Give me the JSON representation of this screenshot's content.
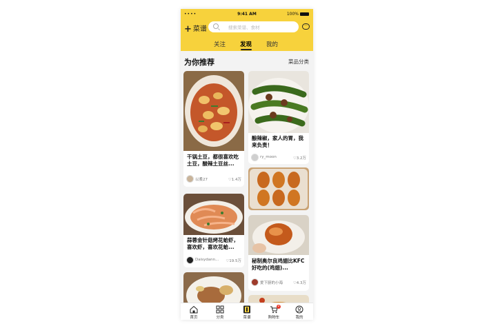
{
  "status": {
    "signal": "••••",
    "time": "9:41 AM",
    "battery": "100%"
  },
  "header": {
    "brand": "菜谱",
    "search_placeholder": "搜索菜谱、食材",
    "tabs": [
      "关注",
      "发现",
      "我的"
    ],
    "active_tab": "发现"
  },
  "section": {
    "title": "为你推荐",
    "more": "菜品分类"
  },
  "left_cards": [
    {
      "title": "干锅土豆，都很喜欢吃土豆，酸辣土豆丝...",
      "author": "以柔27",
      "likes": "1.4万"
    },
    {
      "title": "蒜蓉金针菇烤花蛤虾，喜欢虾，喜欢花蛤...",
      "author": "Daisydann...",
      "likes": "19.5万"
    }
  ],
  "right_cards": [
    {
      "title": "酿辣椒，家人的胃，我来负责！",
      "author": "ry_moon",
      "likes": "3.2万"
    },
    {
      "title": "秘制奥尔良鸡翅比KFC好吃的(鸡翅)...",
      "author": "爱下厨的小海",
      "likes": "4.3万"
    }
  ],
  "tabbar": {
    "items": [
      "首页",
      "分类",
      "菜谱",
      "购物车",
      "我的"
    ],
    "active": "菜谱",
    "cart_badge": "2"
  },
  "colors": {
    "accent": "#f7d23c",
    "badge": "#e8392b"
  }
}
